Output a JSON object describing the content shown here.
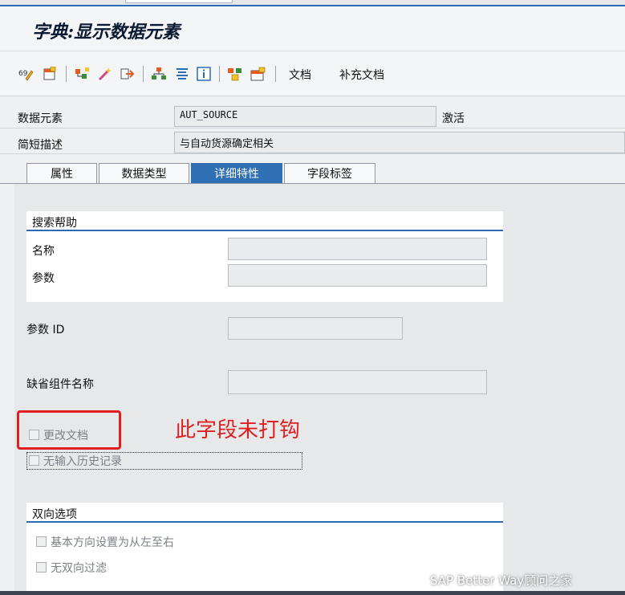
{
  "header": {
    "title": "字典:显示数据元素"
  },
  "toolbar": {
    "icons": [
      "display-change-icon",
      "other-object-icon",
      "where-used-icon",
      "activate-icon",
      "navigate-icon",
      "hierarchy-icon",
      "list-icon",
      "info-icon",
      "network-icon",
      "window-icon"
    ],
    "doc_label": "文档",
    "supp_doc_label": "补充文档"
  },
  "fields": {
    "data_element_label": "数据元素",
    "data_element_value": "AUT_SOURCE",
    "status": "激活",
    "short_desc_label": "简短描述",
    "short_desc_value": "与自动货源确定相关"
  },
  "tabs": [
    {
      "label": "属性",
      "active": false
    },
    {
      "label": "数据类型",
      "active": false
    },
    {
      "label": "详细特性",
      "active": true
    },
    {
      "label": "字段标签",
      "active": false
    }
  ],
  "search_help": {
    "title": "搜索帮助",
    "name_label": "名称",
    "param_label": "参数"
  },
  "param_id_label": "参数 ID",
  "default_comp_label": "缺省组件名称",
  "checkboxes": {
    "change_doc": "更改文档",
    "no_input_history": "无输入历史记录"
  },
  "annotation": "此字段未打钩",
  "bidi": {
    "title": "双向选项",
    "ltr": "基本方向设置为从左至右",
    "no_filter": "无双向过滤"
  },
  "watermark": "SAP Better Way顾问之家",
  "colors": {
    "accent": "#2b6bb1",
    "annotation": "#e02020",
    "tab_active": "#2f6fb3"
  }
}
